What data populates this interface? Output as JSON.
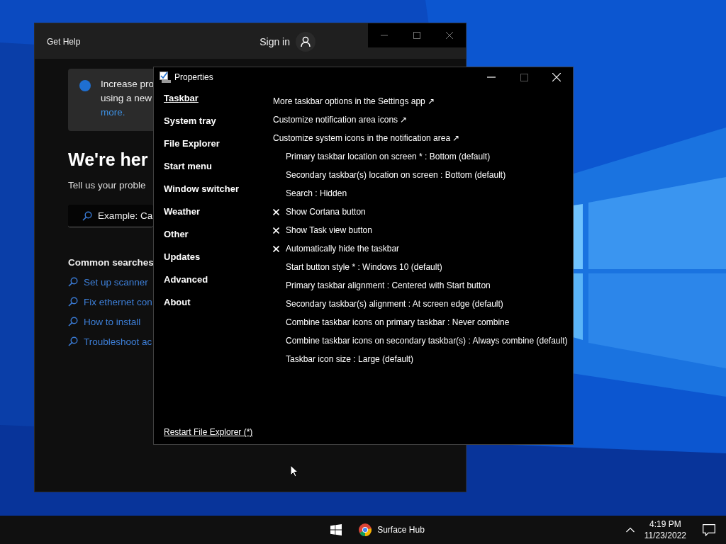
{
  "help_window": {
    "title": "Get Help",
    "sign_in": "Sign in",
    "banner": {
      "lines": [
        "Increase pro",
        "using a new"
      ],
      "link": "more."
    },
    "heading": "We're her",
    "subtitle": "Tell us your proble",
    "search": {
      "placeholder": "Example: Ca"
    },
    "common_searches": {
      "title": "Common searches",
      "links": [
        "Set up scanner",
        "Fix ethernet con",
        "How to install",
        "Troubleshoot ac"
      ]
    }
  },
  "properties_window": {
    "title": "Properties",
    "sidebar": [
      {
        "label": "Taskbar",
        "selected": true
      },
      {
        "label": "System tray",
        "selected": false
      },
      {
        "label": "File Explorer",
        "selected": false
      },
      {
        "label": "Start menu",
        "selected": false
      },
      {
        "label": "Window switcher",
        "selected": false
      },
      {
        "label": "Weather",
        "selected": false
      },
      {
        "label": "Other",
        "selected": false
      },
      {
        "label": "Updates",
        "selected": false
      },
      {
        "label": "Advanced",
        "selected": false
      },
      {
        "label": "About",
        "selected": false
      }
    ],
    "options": [
      {
        "kind": "link",
        "label": "More taskbar options in the Settings app ↗"
      },
      {
        "kind": "link",
        "label": "Customize notification area icons ↗"
      },
      {
        "kind": "link",
        "label": "Customize system icons in the notification area ↗"
      },
      {
        "kind": "choice",
        "label": "Primary taskbar location on screen * : Bottom (default)"
      },
      {
        "kind": "choice",
        "label": "Secondary taskbar(s) location on screen : Bottom (default)"
      },
      {
        "kind": "choice",
        "label": "Search : Hidden"
      },
      {
        "kind": "checkbox",
        "label": "Show Cortana button",
        "checked": true
      },
      {
        "kind": "checkbox",
        "label": "Show Task view button",
        "checked": true
      },
      {
        "kind": "checkbox",
        "label": "Automatically hide the taskbar",
        "checked": true
      },
      {
        "kind": "choice",
        "label": "Start button style * : Windows 10 (default)"
      },
      {
        "kind": "choice",
        "label": "Primary taskbar alignment : Centered with Start button"
      },
      {
        "kind": "choice",
        "label": "Secondary taskbar(s) alignment : At screen edge (default)"
      },
      {
        "kind": "choice",
        "label": "Combine taskbar icons on primary taskbar : Never combine"
      },
      {
        "kind": "choice",
        "label": "Combine taskbar icons on secondary taskbar(s) : Always combine (default)"
      },
      {
        "kind": "choice",
        "label": "Taskbar icon size : Large (default)"
      }
    ],
    "footer_link": "Restart File Explorer (*)"
  },
  "taskbar": {
    "app": "Surface Hub",
    "time": "4:19 PM",
    "date": "11/23/2022"
  }
}
